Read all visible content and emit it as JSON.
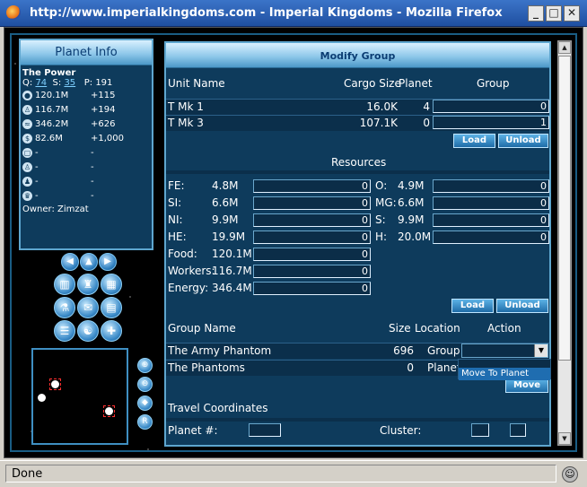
{
  "window": {
    "title": "http://www.imperialkingdoms.com - Imperial Kingdoms - Mozilla Firefox",
    "status": "Done"
  },
  "planet_info": {
    "header": "Planet Info",
    "name": "The Power",
    "q_label": "Q:",
    "q_value": "74",
    "s_label": "S:",
    "s_value": "35",
    "p_label": "P:",
    "p_value": "191",
    "resources": [
      {
        "icon": "fe-icon",
        "value": "120.1M",
        "delta": "+115"
      },
      {
        "icon": "worker-icon",
        "value": "116.7M",
        "delta": "+194"
      },
      {
        "icon": "energy-icon",
        "value": "346.2M",
        "delta": "+626"
      },
      {
        "icon": "credit-icon",
        "value": "82.6M",
        "delta": "+1,000"
      },
      {
        "icon": "building-icon",
        "value": "-",
        "delta": "-"
      },
      {
        "icon": "person-icon",
        "value": "-",
        "delta": "-"
      },
      {
        "icon": "soldier-icon",
        "value": "-",
        "delta": "-"
      },
      {
        "icon": "crown-icon",
        "value": "-",
        "delta": "-"
      }
    ],
    "owner": "Owner: Zimzat"
  },
  "modify_group": {
    "header": "Modify Group",
    "units_headers": {
      "name": "Unit Name",
      "cargo": "Cargo Size",
      "planet": "Planet",
      "group": "Group"
    },
    "units": [
      {
        "name": "T Mk 1",
        "cargo": "16.0K",
        "planet": "4",
        "group": "0"
      },
      {
        "name": "T Mk 3",
        "cargo": "107.1K",
        "planet": "0",
        "group": "1"
      }
    ],
    "load_label": "Load",
    "unload_label": "Unload",
    "resources_header": "Resources",
    "left_resources": [
      {
        "label": "FE:",
        "amount": "4.8M",
        "input": "0"
      },
      {
        "label": "SI:",
        "amount": "6.6M",
        "input": "0"
      },
      {
        "label": "NI:",
        "amount": "9.9M",
        "input": "0"
      },
      {
        "label": "HE:",
        "amount": "19.9M",
        "input": "0"
      },
      {
        "label": "Food:",
        "amount": "120.1M",
        "input": "0"
      },
      {
        "label": "Workers:",
        "amount": "116.7M",
        "input": "0"
      },
      {
        "label": "Energy:",
        "amount": "346.4M",
        "input": "0"
      }
    ],
    "right_resources": [
      {
        "label": "O:",
        "amount": "4.9M",
        "input": "0"
      },
      {
        "label": "MG:",
        "amount": "6.6M",
        "input": "0"
      },
      {
        "label": "S:",
        "amount": "9.9M",
        "input": "0"
      },
      {
        "label": "H:",
        "amount": "20.0M",
        "input": "0"
      }
    ],
    "group_headers": {
      "name": "Group Name",
      "size": "Size",
      "location": "Location",
      "action": "Action"
    },
    "groups": [
      {
        "name": "The Army Phantom",
        "size": "696",
        "location": "Group"
      },
      {
        "name": "The Phantoms",
        "size": "0",
        "location": "Planet"
      }
    ],
    "dropdown_option": "Move To Planet",
    "move_label": "Move",
    "travel_header": "Travel Coordinates",
    "planet_label": "Planet #:",
    "cluster_label": "Cluster:"
  }
}
